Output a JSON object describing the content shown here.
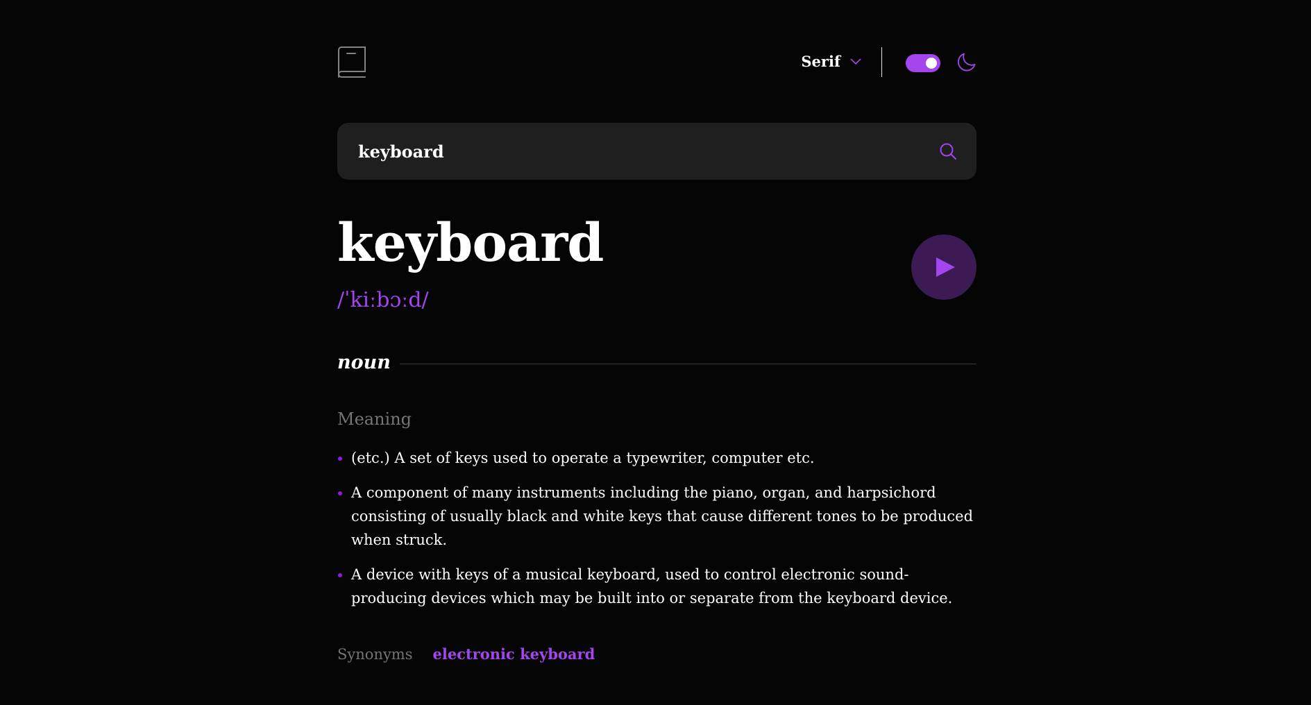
{
  "header": {
    "logo_icon": "book-icon",
    "font_selector": {
      "selected": "Serif",
      "icon": "chevron-down-icon"
    },
    "theme_toggle": {
      "state": "on",
      "icon": "moon-icon"
    }
  },
  "search": {
    "value": "keyboard",
    "icon": "search-icon"
  },
  "entry": {
    "word": "keyboard",
    "phonetic": "/ˈkiːbɔːd/",
    "play_icon": "play-icon",
    "part_of_speech": "noun",
    "meaning_heading": "Meaning",
    "definitions": [
      "(etc.) A set of keys used to operate a typewriter, computer etc.",
      "A component of many instruments including the piano, organ, and harpsichord consisting of usually black and white keys that cause different tones to be produced when struck.",
      "A device with keys of a musical keyboard, used to control electronic sound-producing devices which may be built into or separate from the keyboard device."
    ],
    "synonyms_label": "Synonyms",
    "synonyms": [
      "electronic keyboard"
    ]
  },
  "colors": {
    "accent": "#a445ed",
    "background": "#050505",
    "search_bg": "#1f1f1f",
    "play_bg": "#3c1b54",
    "muted_text": "#757575"
  }
}
